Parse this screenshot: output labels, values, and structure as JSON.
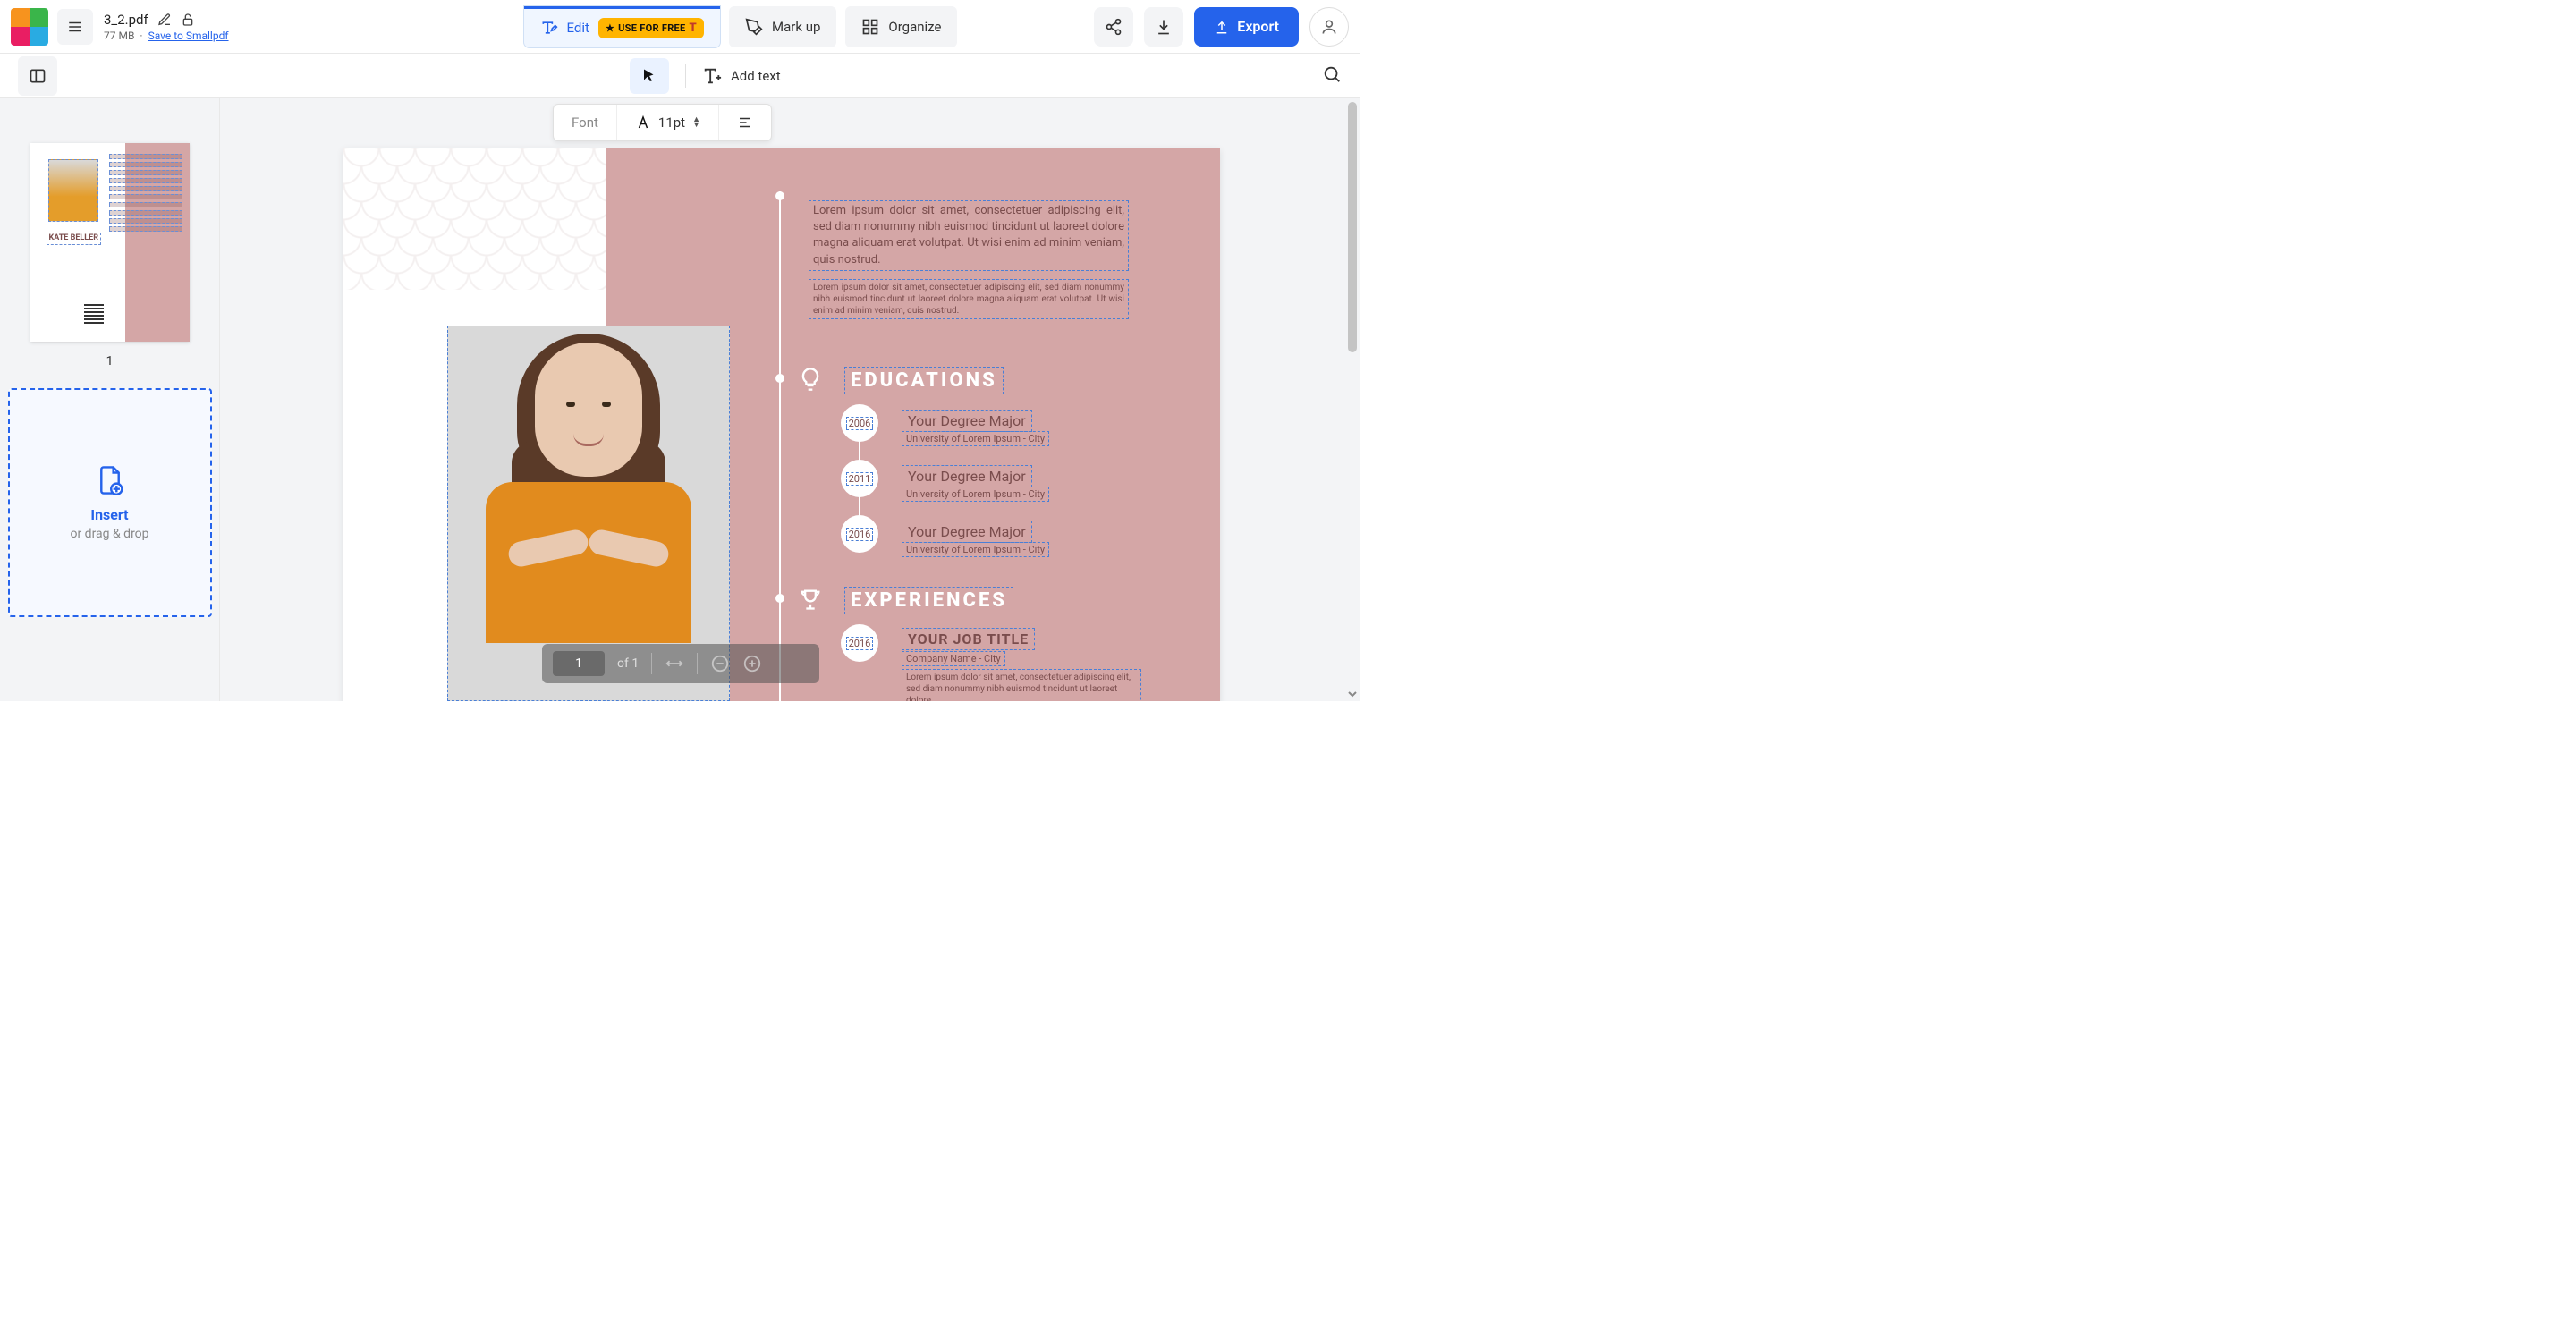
{
  "header": {
    "file_name": "3_2.pdf",
    "file_size": "77 MB",
    "separator": "·",
    "save_link": "Save to Smallpdf",
    "tools": {
      "edit": "Edit",
      "use_free": "USE FOR FREE",
      "markup": "Mark up",
      "organize": "Organize"
    },
    "export": "Export"
  },
  "subbar": {
    "add_text": "Add text"
  },
  "font_toolbar": {
    "font_label": "Font",
    "size": "11pt"
  },
  "sidebar": {
    "page_number": "1",
    "thumb_name": "KATE BELLER",
    "insert_title": "Insert",
    "insert_sub": "or drag & drop"
  },
  "document": {
    "intro1": "Lorem ipsum dolor sit amet, consectetuer adipiscing elit, sed diam nonummy nibh euismod tincidunt ut laoreet dolore magna aliquam erat volutpat. Ut wisi enim ad minim veniam, quis nostrud.",
    "intro2": "Lorem ipsum dolor sit amet, consectetuer adipiscing elit, sed diam nonummy nibh euismod tincidunt ut laoreet dolore magna aliquam erat volutpat. Ut wisi enim ad minim veniam, quis nostrud.",
    "sections": {
      "educations": "EDUCATIONS",
      "experiences": "EXPERIENCES"
    },
    "education": [
      {
        "year": "2006",
        "title": "Your Degree Major",
        "sub": "University of Lorem Ipsum - City"
      },
      {
        "year": "2011",
        "title": "Your Degree Major",
        "sub": "University of Lorem Ipsum - City"
      },
      {
        "year": "2016",
        "title": "Your Degree Major",
        "sub": "University of Lorem Ipsum - City"
      }
    ],
    "experience": {
      "year": "2016",
      "title": "YOUR JOB TITLE",
      "sub": "Company Name - City",
      "desc": "Lorem ipsum dolor sit amet, consectetuer adipiscing elit, sed diam nonummy nibh euismod tincidunt ut laoreet dolore"
    }
  },
  "page_controls": {
    "current": "1",
    "of_label": "of 1"
  }
}
